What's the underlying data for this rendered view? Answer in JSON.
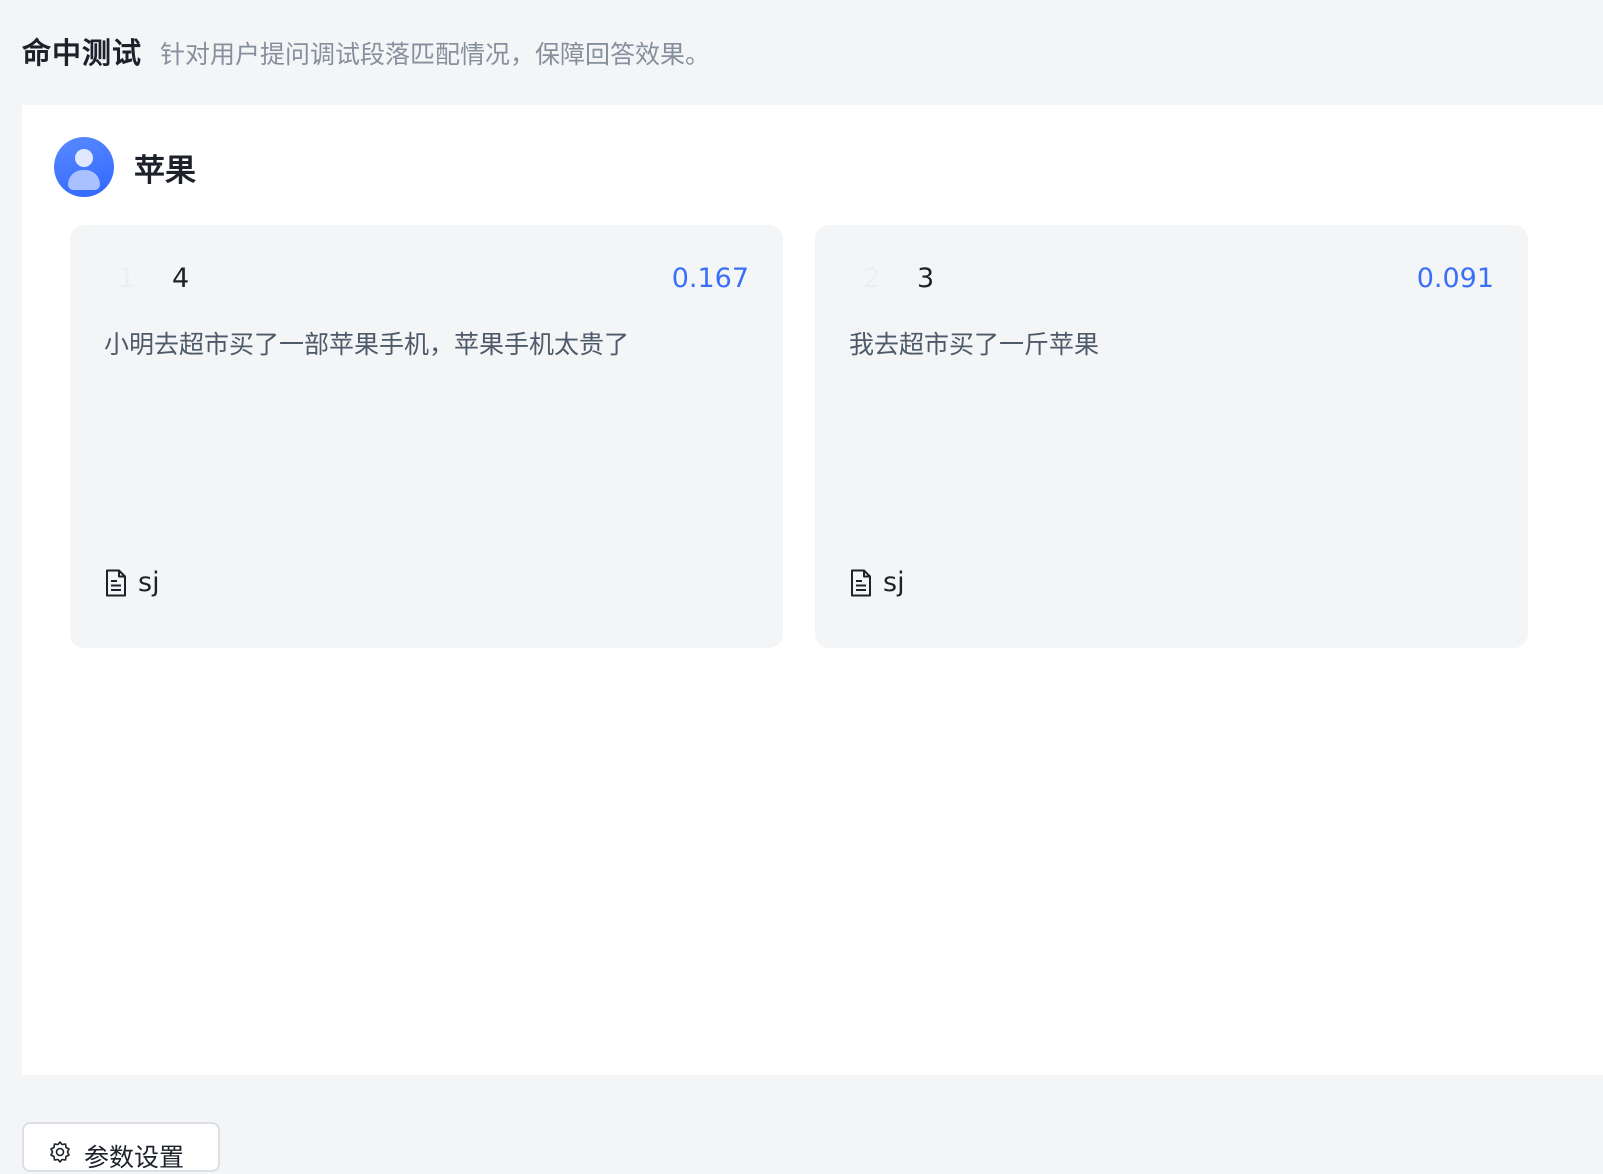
{
  "header": {
    "title": "命中测试",
    "subtitle": "针对用户提问调试段落匹配情况，保障回答效果。"
  },
  "query": {
    "text": "苹果"
  },
  "results": [
    {
      "index": "1",
      "id": "4",
      "score": "0.167",
      "content": "小明去超市买了一部苹果手机，苹果手机太贵了",
      "source": "sj"
    },
    {
      "index": "2",
      "id": "3",
      "score": "0.091",
      "content": "我去超市买了一斤苹果",
      "source": "sj"
    }
  ],
  "settings": {
    "label": "参数设置"
  },
  "colors": {
    "accent": "#3a6ff7",
    "background": "#f4f5f7"
  }
}
